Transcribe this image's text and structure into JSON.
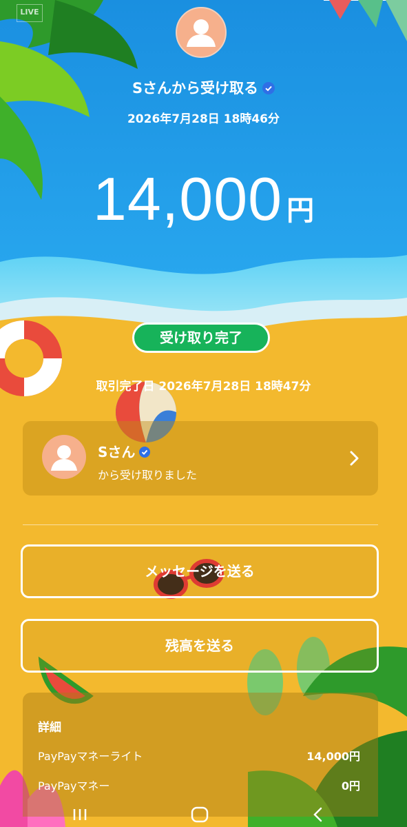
{
  "status_bar": {
    "live_label": "LIVE"
  },
  "header": {
    "title": "Sさんから受け取る",
    "datetime": "2026年7月28日 18時46分"
  },
  "amount": {
    "value": "14,000",
    "unit": "円"
  },
  "status": {
    "badge": "受け取り完了",
    "completed_at": "取引完了日 2026年7月28日 18時47分"
  },
  "sender": {
    "name": "Sさん",
    "subtitle": "から受け取りました"
  },
  "actions": {
    "send_message": "メッセージを送る",
    "send_balance": "残高を送る"
  },
  "details": {
    "title": "詳細",
    "rows": [
      {
        "label": "PayPayマネーライト",
        "value": "14,000円"
      },
      {
        "label": "PayPayマネー",
        "value": "0円"
      }
    ]
  },
  "colors": {
    "sky": "#1f9ce8",
    "sand": "#f3b92e",
    "badge_green": "#17b35a",
    "verified_blue": "#2f6fe6",
    "avatar": "#f6b08c"
  },
  "icons": [
    "verified-check-icon",
    "chevron-right-icon",
    "avatar-person-icon",
    "nav-recent-icon",
    "nav-home-icon",
    "nav-back-icon"
  ]
}
